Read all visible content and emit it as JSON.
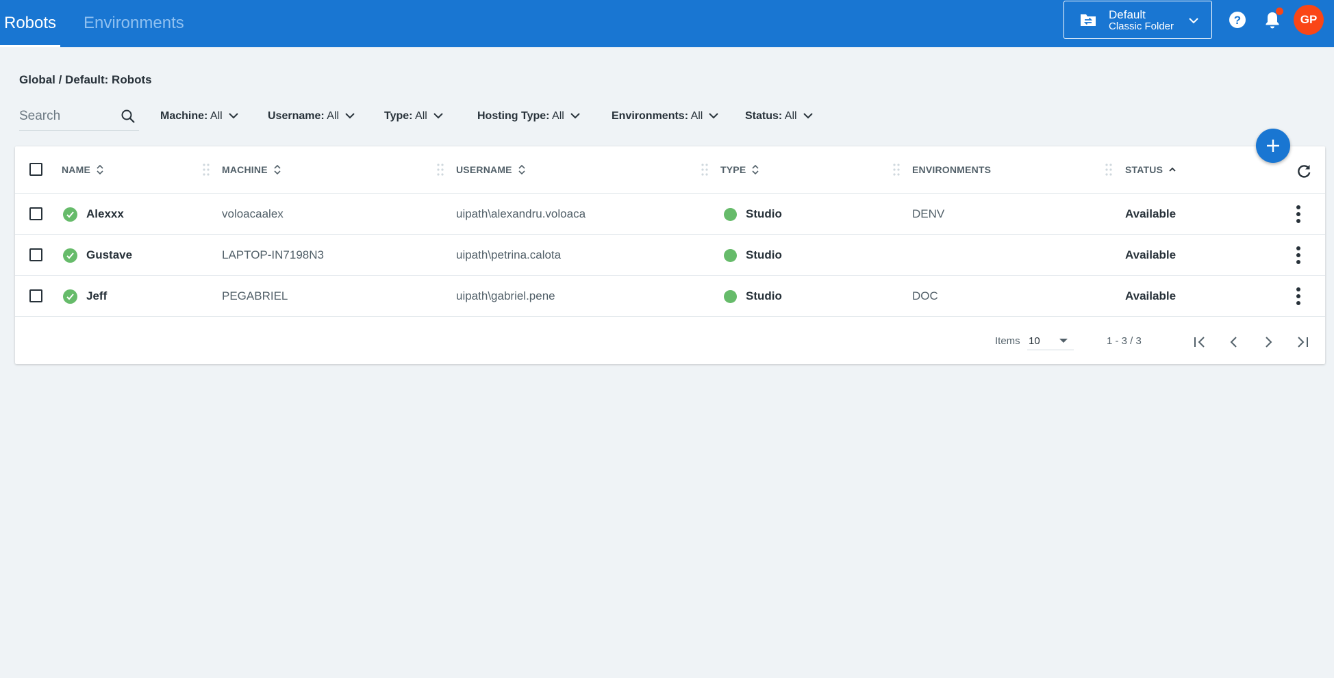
{
  "header": {
    "tabs": [
      {
        "label": "Robots",
        "active": true
      },
      {
        "label": "Environments",
        "active": false
      }
    ],
    "folder": {
      "title": "Default",
      "subtitle": "Classic Folder",
      "icon": "folder-swap-icon"
    },
    "avatar_initials": "GP",
    "colors": {
      "bar": "#1976d2",
      "accent": "#fa4616"
    }
  },
  "breadcrumb": "Global / Default: Robots",
  "search": {
    "placeholder": "Search",
    "value": ""
  },
  "filters": [
    {
      "label": "Machine:",
      "value": "All"
    },
    {
      "label": "Username:",
      "value": "All"
    },
    {
      "label": "Type:",
      "value": "All"
    },
    {
      "label": "Hosting Type:",
      "value": "All"
    },
    {
      "label": "Environments:",
      "value": "All"
    },
    {
      "label": "Status:",
      "value": "All"
    }
  ],
  "table": {
    "columns": [
      "NAME",
      "MACHINE",
      "USERNAME",
      "TYPE",
      "ENVIRONMENTS",
      "STATUS"
    ],
    "sort": {
      "column": "STATUS",
      "direction": "ascending"
    },
    "rows": [
      {
        "name": "Alexxx",
        "machine": "voloacaalex",
        "username": "uipath\\alexandru.voloaca",
        "type": "Studio",
        "environments": "DENV",
        "status": "Available"
      },
      {
        "name": "Gustave",
        "machine": "LAPTOP-IN7198N3",
        "username": "uipath\\petrina.calota",
        "type": "Studio",
        "environments": "",
        "status": "Available"
      },
      {
        "name": "Jeff",
        "machine": "PEGABRIEL",
        "username": "uipath\\gabriel.pene",
        "type": "Studio",
        "environments": "DOC",
        "status": "Available"
      }
    ],
    "status_color": "#66bb6a"
  },
  "pagination": {
    "items_label": "Items",
    "page_size": "10",
    "range": "1 - 3 / 3"
  }
}
